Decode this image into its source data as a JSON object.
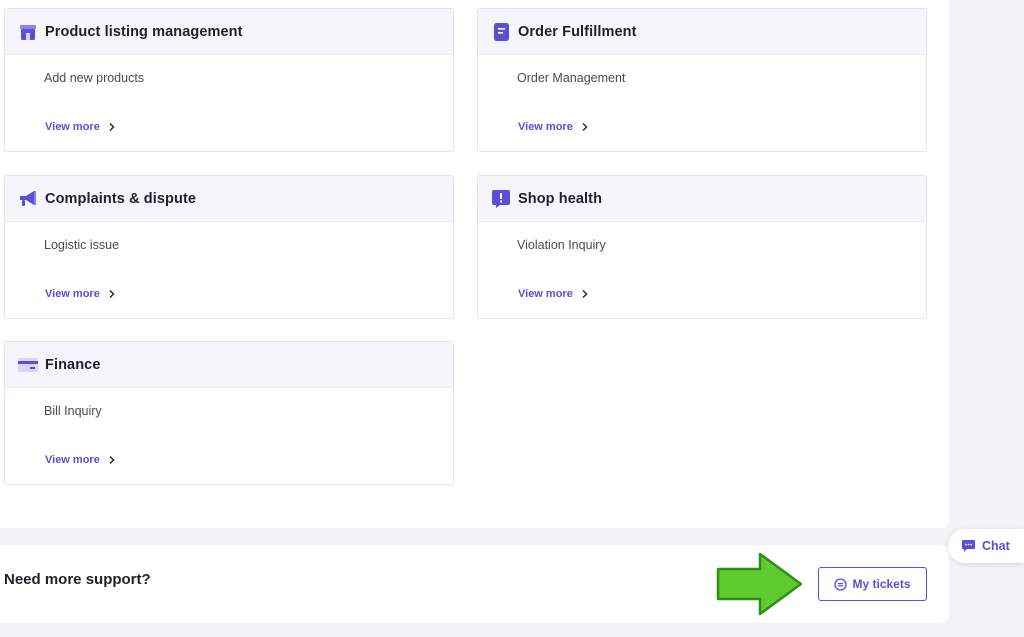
{
  "cards": [
    {
      "title": "Product listing management",
      "subtitle": "Add new products",
      "link": "View more",
      "icon": "store-icon"
    },
    {
      "title": "Order Fulfillment",
      "subtitle": "Order Management",
      "link": "View more",
      "icon": "document-icon"
    },
    {
      "title": "Complaints & dispute",
      "subtitle": "Logistic issue",
      "link": "View more",
      "icon": "megaphone-icon"
    },
    {
      "title": "Shop health",
      "subtitle": "Violation Inquiry",
      "link": "View more",
      "icon": "alert-icon"
    },
    {
      "title": "Finance",
      "subtitle": "Bill Inquiry",
      "link": "View more",
      "icon": "credit-card-icon"
    }
  ],
  "support": {
    "title": "Need more support?",
    "tickets_label": "My tickets"
  },
  "chat": {
    "label": "Chat"
  },
  "colors": {
    "accent": "#5b4fd6",
    "arrow": "#5ecb2e"
  }
}
